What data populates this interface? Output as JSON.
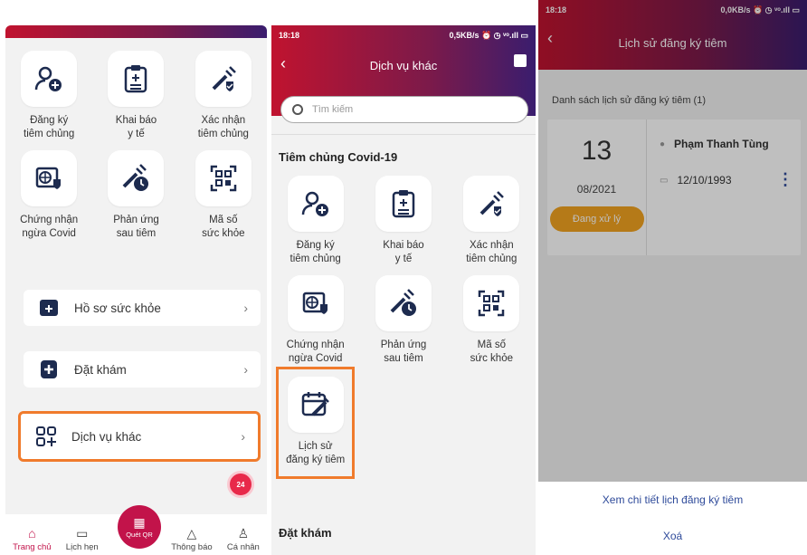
{
  "panel1": {
    "grid": [
      {
        "label": "Đăng ký\ntiêm chủng",
        "icon": "person-add-icon"
      },
      {
        "label": "Khai báo\ny tế",
        "icon": "clipboard-icon"
      },
      {
        "label": "Xác nhận\ntiêm chủng",
        "icon": "syringe-shield-icon"
      },
      {
        "label": "Chứng nhận\nngừa Covid",
        "icon": "certificate-icon"
      },
      {
        "label": "Phản ứng\nsau tiêm",
        "icon": "syringe-clock-icon"
      },
      {
        "label": "Mã số\nsức khỏe",
        "icon": "qr-code-icon"
      }
    ],
    "cards": {
      "health_record": "Hồ sơ sức khỏe",
      "booking": "Đặt khám",
      "other_services": "Dịch vụ khác",
      "chevron": "›"
    },
    "fab_label": "24",
    "bottom_nav": {
      "home": "Trang chủ",
      "appointments": "Lịch hẹn",
      "scan_qr": "Quét QR",
      "notifications": "Thông báo",
      "profile": "Cá nhân"
    }
  },
  "panel2": {
    "status": {
      "time": "18:18",
      "right": "0,5KB/s ⏰ ◷ ᵛᵒ.ıll ▭"
    },
    "title": "Dịch vụ khác",
    "back": "‹",
    "search_placeholder": "Tìm kiếm",
    "section1": "Tiêm chủng Covid-19",
    "grid": [
      {
        "label": "Đăng ký\ntiêm chủng",
        "icon": "person-add-icon"
      },
      {
        "label": "Khai báo\ny tế",
        "icon": "clipboard-icon"
      },
      {
        "label": "Xác nhận\ntiêm chủng",
        "icon": "syringe-shield-icon"
      },
      {
        "label": "Chứng nhận\nngừa Covid",
        "icon": "certificate-icon"
      },
      {
        "label": "Phản ứng\nsau tiêm",
        "icon": "syringe-clock-icon"
      },
      {
        "label": "Mã số\nsức khỏe",
        "icon": "qr-code-icon"
      },
      {
        "label": "Lịch sử\nđăng ký tiêm",
        "icon": "calendar-syringe-icon"
      }
    ],
    "section2": "Đặt khám"
  },
  "panel3": {
    "status": {
      "time": "18:18",
      "right": "0,0KB/s ⏰ ◷ ᵛᵒ.ıll ▭"
    },
    "title": "Lịch sử đăng ký tiêm",
    "back": "‹",
    "list_title": "Danh sách lịch sử đăng ký tiêm (1)",
    "record": {
      "day": "13",
      "month": "08/2021",
      "status": "Đang xử lý",
      "name": "Phạm Thanh Tùng",
      "dob": "12/10/1993",
      "more": "⋮"
    },
    "actions": {
      "view_detail": "Xem chi tiết lịch đăng ký tiêm",
      "delete": "Xoá"
    }
  },
  "colors": {
    "brand": "#c0132f",
    "highlight": "#f07b2c",
    "pending": "#f2a321",
    "action_text": "#2e4a9a"
  }
}
